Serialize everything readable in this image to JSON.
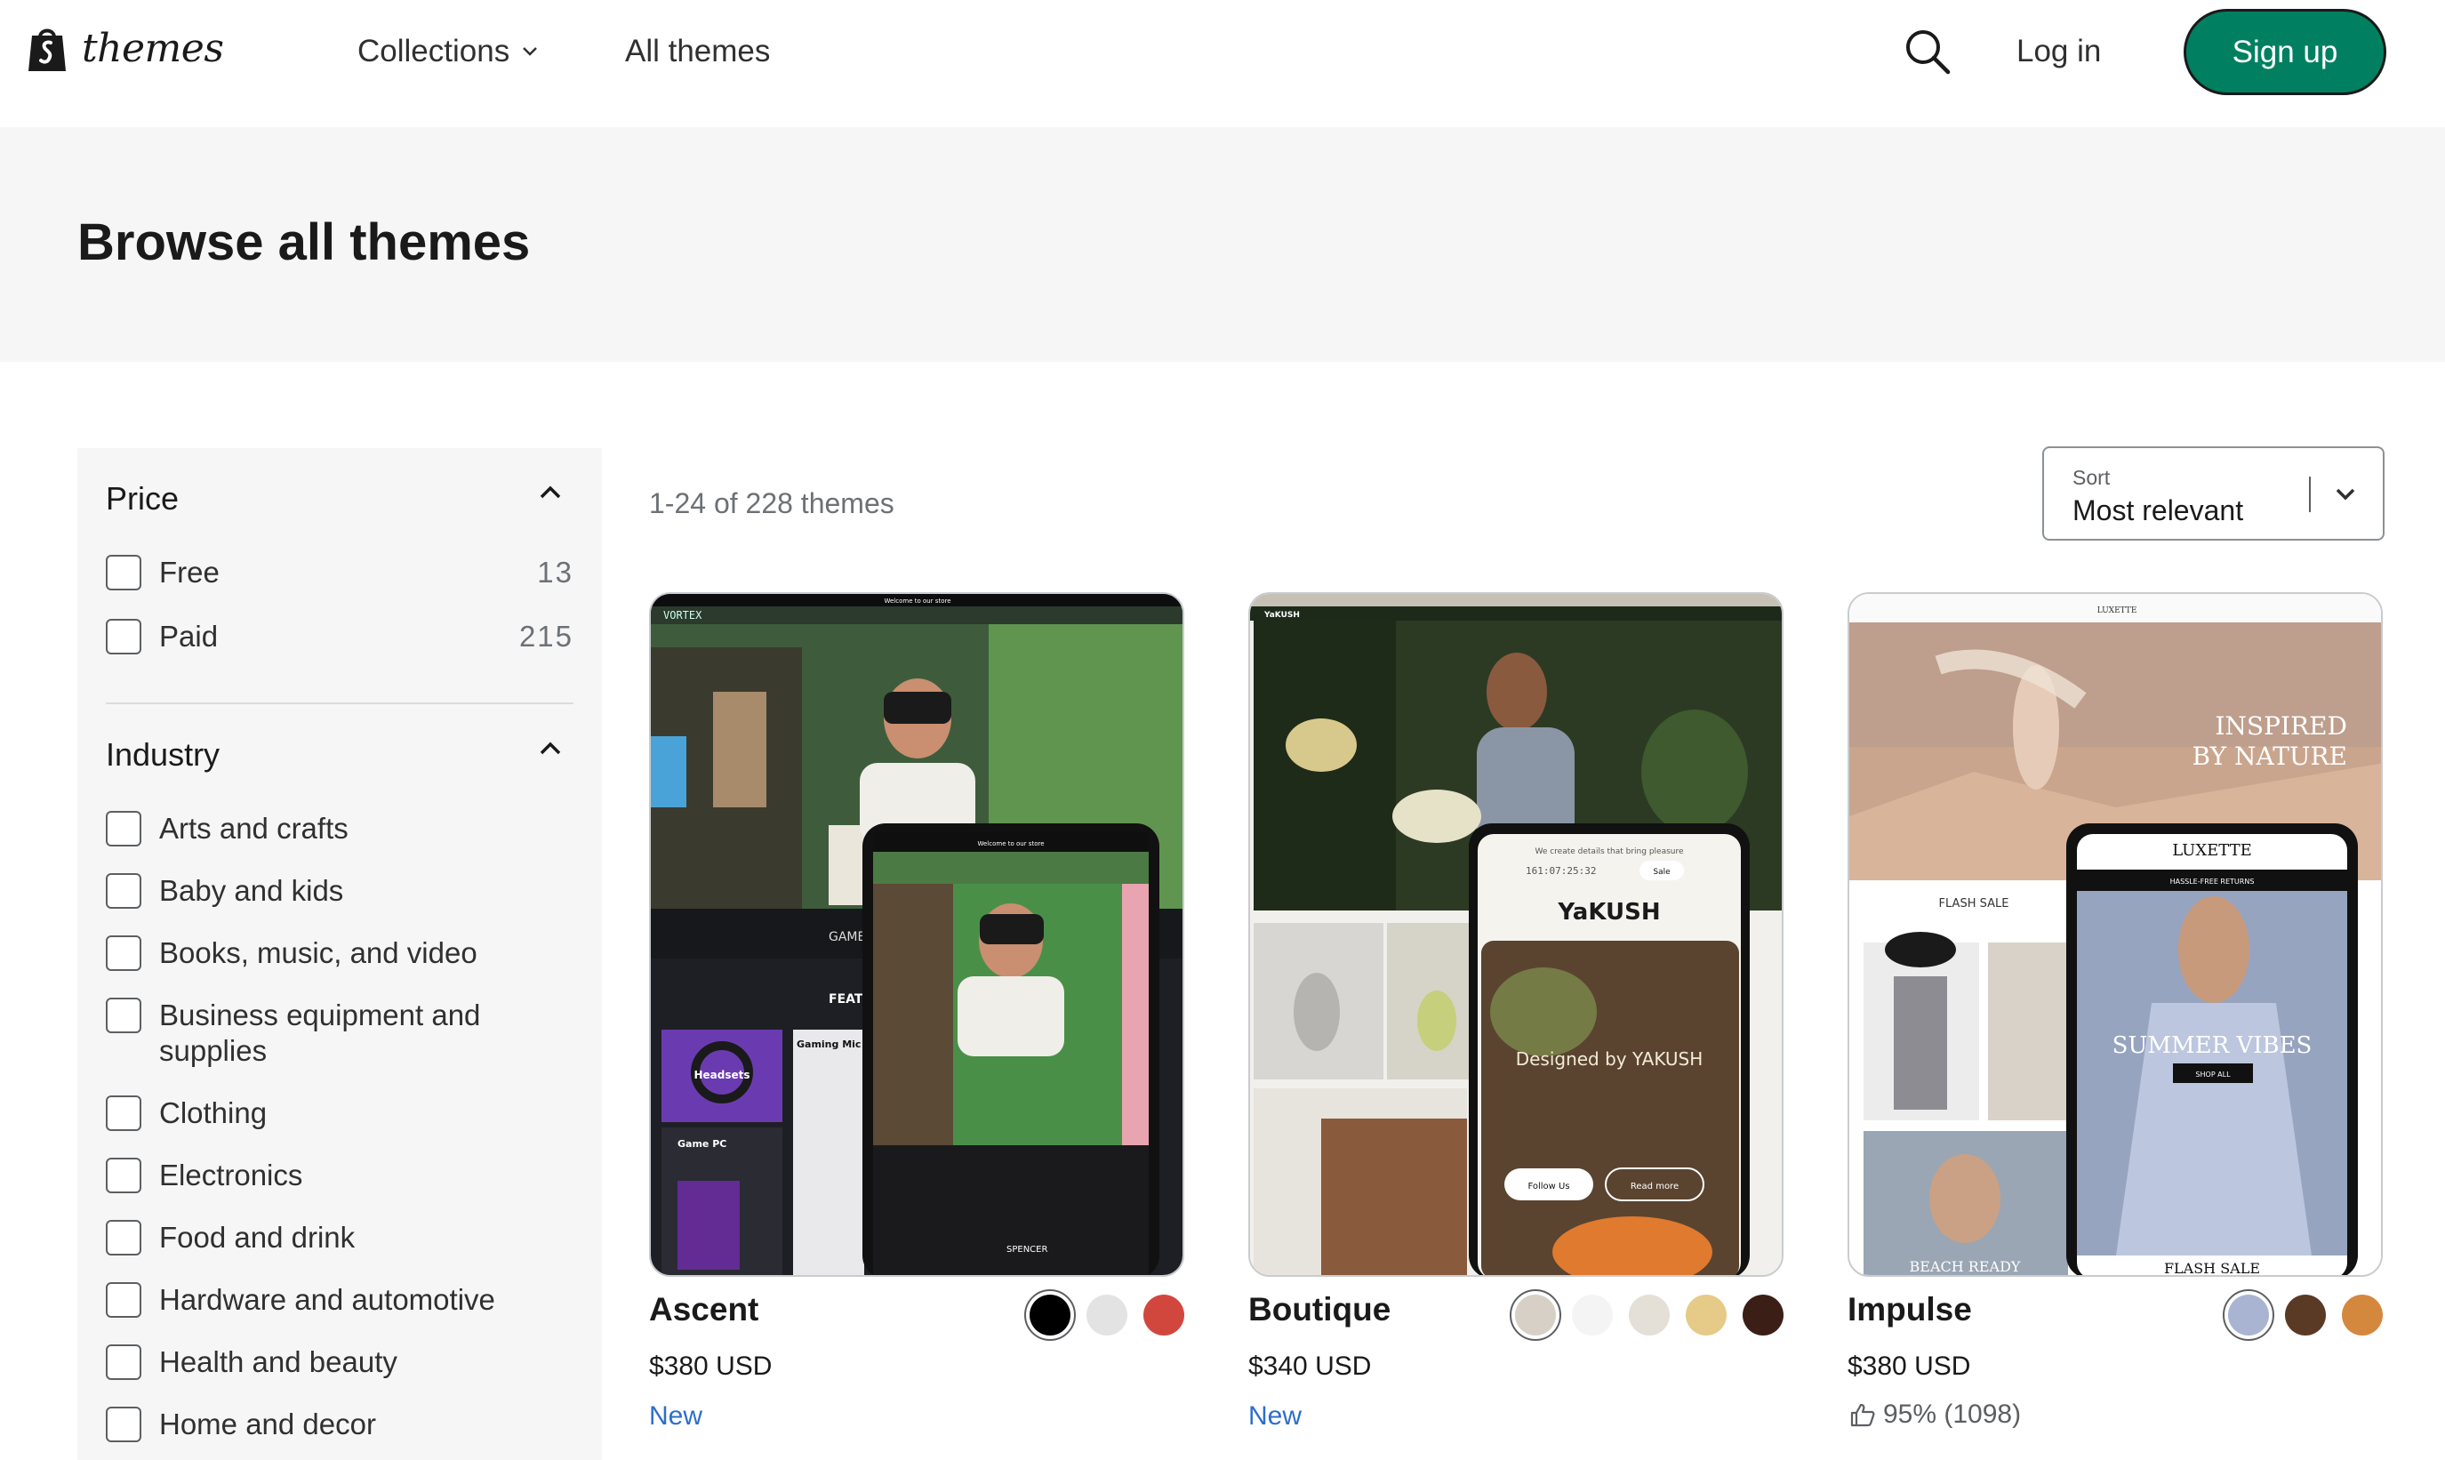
{
  "header": {
    "brand": "themes",
    "nav": [
      {
        "label": "Collections"
      },
      {
        "label": "All themes"
      }
    ],
    "login_label": "Log in",
    "signup_label": "Sign up"
  },
  "hero": {
    "title": "Browse all themes"
  },
  "filters": {
    "price": {
      "heading": "Price",
      "options": [
        {
          "label": "Free",
          "count": "13"
        },
        {
          "label": "Paid",
          "count": "215"
        }
      ]
    },
    "industry": {
      "heading": "Industry",
      "options": [
        {
          "label": "Arts and crafts"
        },
        {
          "label": "Baby and kids"
        },
        {
          "label": "Books, music, and video"
        },
        {
          "label": "Business equipment and supplies"
        },
        {
          "label": "Clothing"
        },
        {
          "label": "Electronics"
        },
        {
          "label": "Food and drink"
        },
        {
          "label": "Hardware and automotive"
        },
        {
          "label": "Health and beauty"
        },
        {
          "label": "Home and decor"
        }
      ]
    }
  },
  "results": {
    "count_text": "1-24 of 228 themes",
    "sort_label": "Sort",
    "sort_value": "Most relevant"
  },
  "themes": [
    {
      "name": "Ascent",
      "price": "$380 USD",
      "badge": "New",
      "swatches": [
        "#000000",
        "#e3e3e3",
        "#d1473e"
      ],
      "selected_swatch": 0,
      "preview_texts": [
        "Welcome to our store",
        "FEAT",
        "Headsets",
        "Game PC",
        "Gaming Mic",
        "SPENCER"
      ]
    },
    {
      "name": "Boutique",
      "price": "$340 USD",
      "badge": "New",
      "swatches": [
        "#d6d0c6",
        "#f4f4f4",
        "#e4e0d7",
        "#e6ca88",
        "#3b1e15"
      ],
      "selected_swatch": 0,
      "preview_texts": [
        "YaKUSH",
        "We create details that bring pleasure",
        "Sale",
        "Designed by YAKUSH",
        "Follow Us",
        "Read more"
      ]
    },
    {
      "name": "Impulse",
      "price": "$380 USD",
      "rating": "95% (1098)",
      "swatches": [
        "#a9b4d3",
        "#5a3a25",
        "#d4883e"
      ],
      "selected_swatch": 0,
      "preview_texts": [
        "INSPIRED",
        "BY NATURE",
        "LUXETTE",
        "FLASH SALE",
        "SUMMER VIBES",
        "SHOP ALL",
        "HASSLE-FREE RETURNS",
        "BEACH READY",
        "FLASH SALE"
      ]
    }
  ]
}
